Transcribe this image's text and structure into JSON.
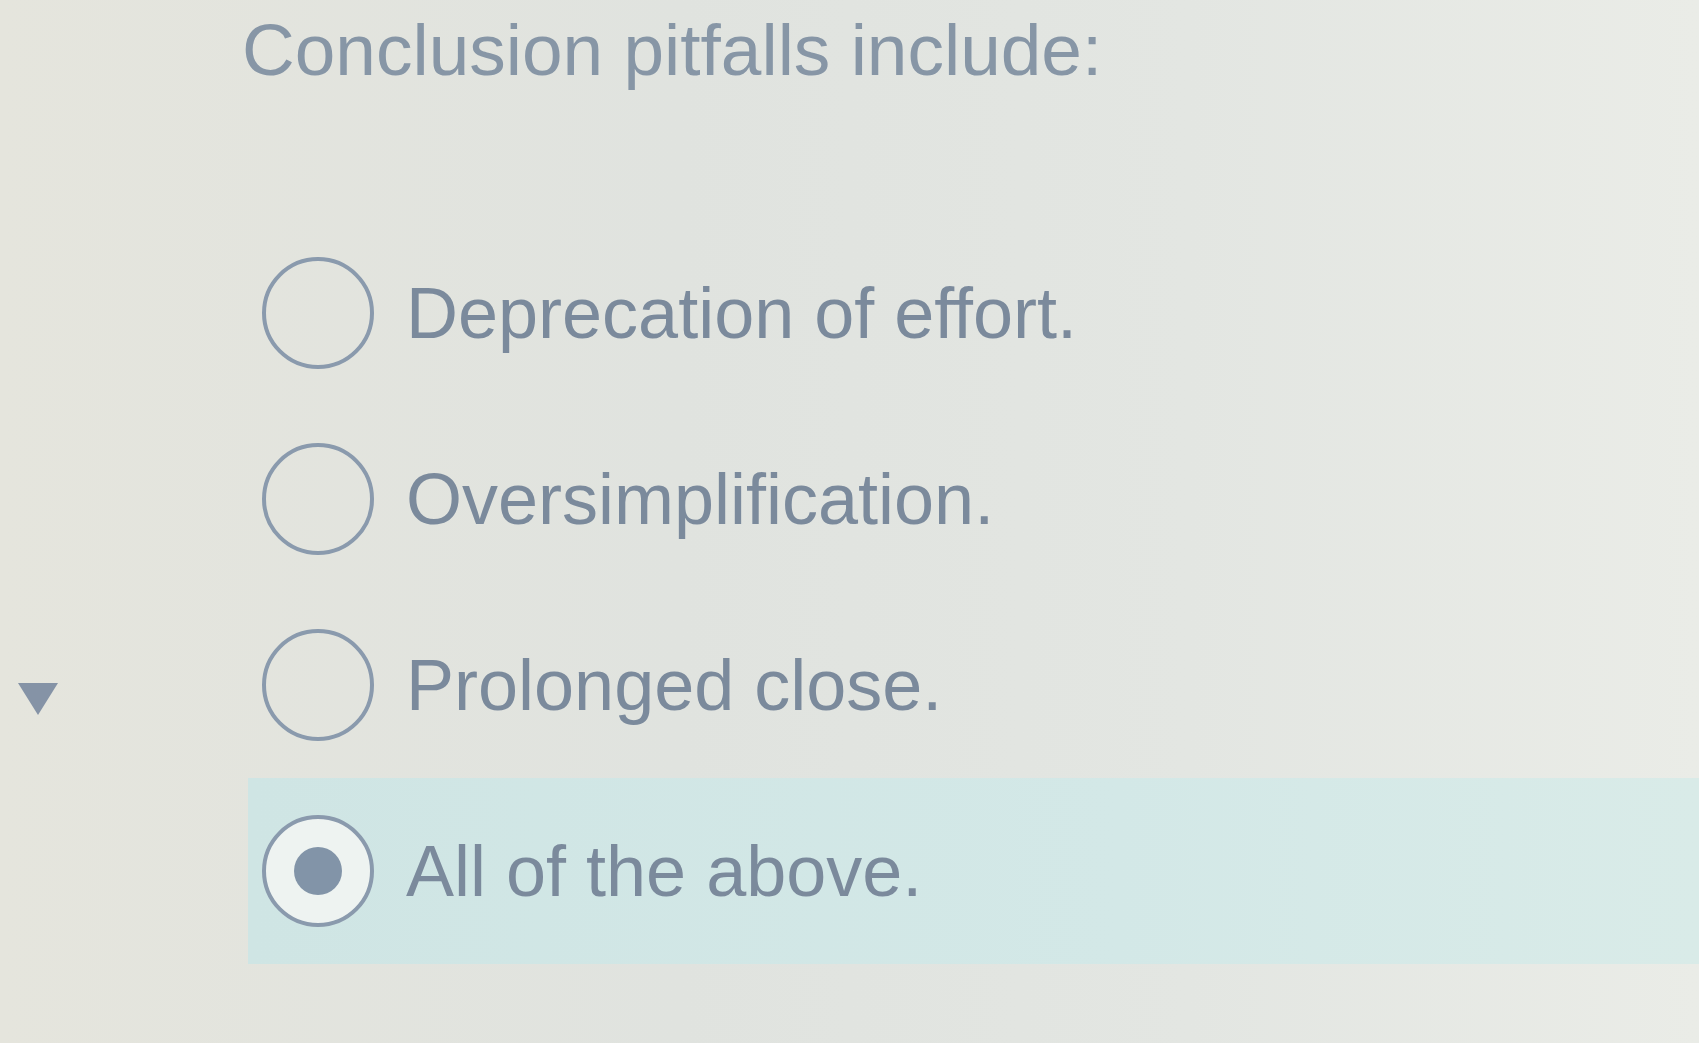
{
  "question": {
    "text": "Conclusion pitfalls include:"
  },
  "options": [
    {
      "label": "Deprecation of effort.",
      "selected": false
    },
    {
      "label": "Oversimplification.",
      "selected": false
    },
    {
      "label": "Prolonged close.",
      "selected": false
    },
    {
      "label": "All of the above.",
      "selected": true
    }
  ]
}
